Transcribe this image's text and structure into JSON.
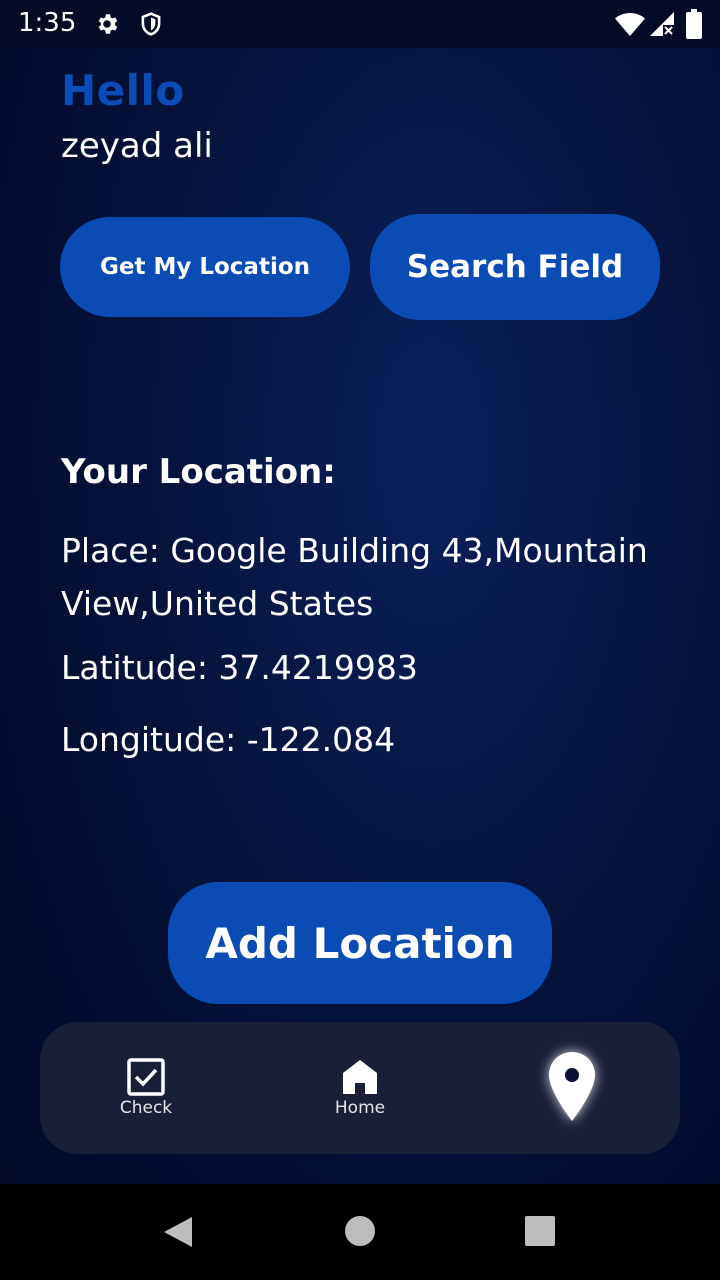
{
  "status_bar": {
    "time": "1:35",
    "icons": [
      "gear-icon",
      "shield-icon",
      "wifi-icon",
      "signal-icon",
      "battery-icon"
    ]
  },
  "header": {
    "greeting": "Hello",
    "user_name": "zeyad ali"
  },
  "actions": {
    "get_location_label": "Get My Location",
    "search_field_label": "Search Field"
  },
  "location": {
    "heading": "Your Location:",
    "place": "Place: Google Building 43,Mountain View,United States",
    "latitude": "Latitude: 37.4219983",
    "longitude": "Longitude: -122.084"
  },
  "add_location_label": "Add Location",
  "bottom_nav": {
    "items": [
      {
        "label": "Check",
        "icon": "checkbox-icon"
      },
      {
        "label": "Home",
        "icon": "home-icon"
      },
      {
        "label": "",
        "icon": "location-pin-icon",
        "selected": true
      }
    ]
  },
  "colors": {
    "accent": "#0a4cb3",
    "greeting": "#0a4cb8",
    "nav_bg": "#1a1f38"
  },
  "system_nav": [
    "back-icon",
    "home-circle-icon",
    "recents-icon"
  ]
}
